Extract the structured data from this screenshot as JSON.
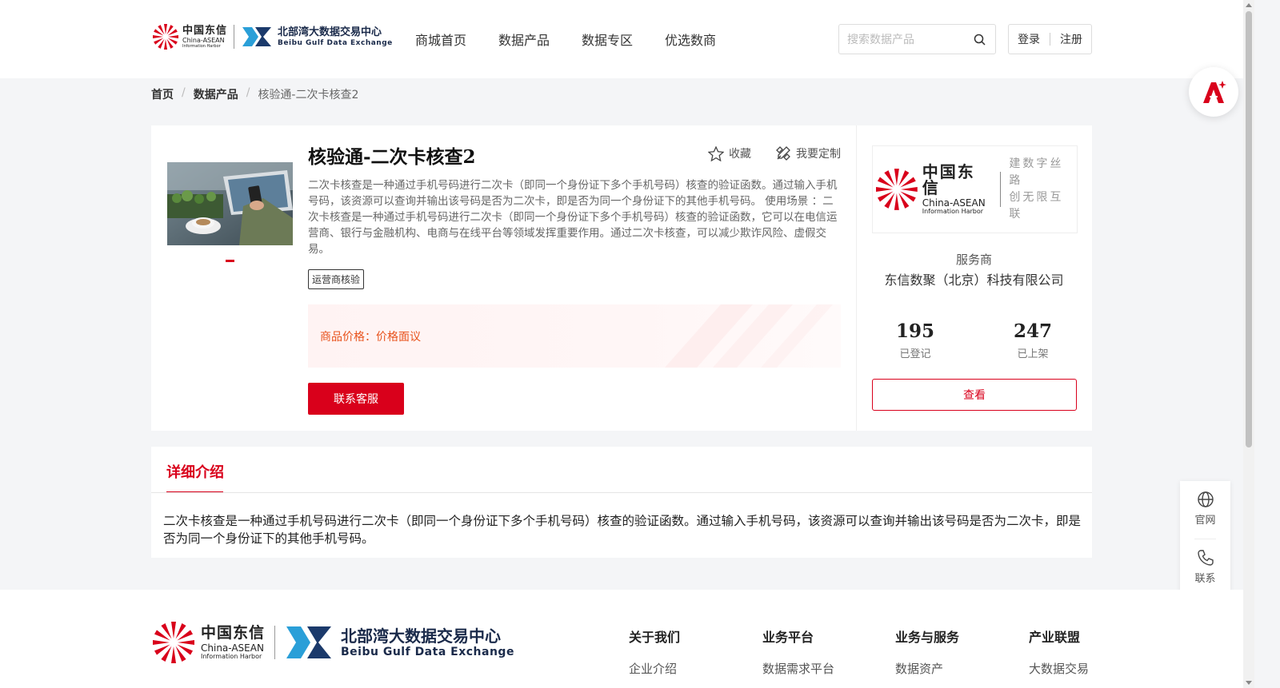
{
  "header": {
    "logo": {
      "ct_cn": "中国东信",
      "ct_en1": "China-ASEAN",
      "ct_en2": "Information Harbor",
      "bx_cn": "北部湾大数据交易中心",
      "bx_en": "Beibu Gulf Data Exchange"
    },
    "nav": [
      "商城首页",
      "数据产品",
      "数据专区",
      "优选数商"
    ],
    "search_placeholder": "搜索数据产品",
    "login": "登录",
    "register": "注册"
  },
  "breadcrumb": [
    "首页",
    "数据产品",
    "核验通-二次卡核查2"
  ],
  "product": {
    "title": "核验通-二次卡核查2",
    "favorite": "收藏",
    "customize": "我要定制",
    "description": "二次卡核查是一种通过手机号码进行二次卡（即同一个身份证下多个手机号码）核查的验证函数。通过输入手机号码，该资源可以查询并输出该号码是否为二次卡，即是否为同一个身份证下的其他手机号码。 使用场景 ：二次卡核查是一种通过手机号码进行二次卡（即同一个身份证下多个手机号码）核查的验证函数，它可以在电信运营商、银行与金融机构、电商与在线平台等领域发挥重要作用。通过二次卡核查，可以减少欺诈风险、虚假交易。",
    "tag": "运营商核验",
    "price_label": "商品价格：",
    "price_value": "价格面议",
    "contact": "联系客服"
  },
  "merchant": {
    "logo_cn": "中国东信",
    "logo_en1": "China-ASEAN",
    "logo_en2": "Information Harbor",
    "slogan_1": "建数字丝路",
    "slogan_2": "创无限互联",
    "label": "服务商",
    "name": "东信数聚（北京）科技有限公司",
    "stats": [
      {
        "num": "195",
        "label": "已登记"
      },
      {
        "num": "247",
        "label": "已上架"
      }
    ],
    "view": "查看"
  },
  "detail": {
    "tab": "详细介绍",
    "text": "二次卡核查是一种通过手机号码进行二次卡（即同一个身份证下多个手机号码）核查的验证函数。通过输入手机号码，该资源可以查询并输出该号码是否为二次卡，即是否为同一个身份证下的其他手机号码。"
  },
  "side": {
    "official": "官网",
    "contact": "联系"
  },
  "footer": {
    "logo": {
      "ct_cn": "中国东信",
      "ct_en1": "China-ASEAN",
      "ct_en2": "Information Harbor",
      "bx_cn": "北部湾大数据交易中心",
      "bx_en": "Beibu Gulf Data Exchange"
    },
    "columns": [
      {
        "title": "关于我们",
        "link": "企业介绍"
      },
      {
        "title": "业务平台",
        "link": "数据需求平台"
      },
      {
        "title": "业务与服务",
        "link": "数据资产"
      },
      {
        "title": "产业联盟",
        "link": "大数据交易"
      }
    ]
  },
  "colors": {
    "brand_red": "#d9001b",
    "price_orange": "#e8531d"
  }
}
